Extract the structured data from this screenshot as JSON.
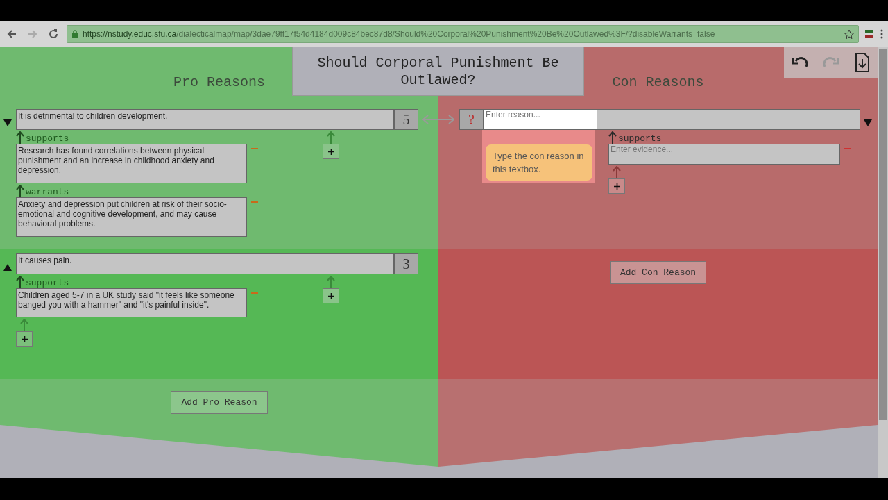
{
  "browser": {
    "url_host": "https://nstudy.educ.sfu.ca",
    "url_path": "/dialecticalmap/map/3dae79ff17f54d4184d009c84bec87d8/Should%20Corporal%20Punishment%20Be%20Outlawed%3F/?disableWarrants=false",
    "forward_disabled": true
  },
  "title": "Should Corporal Punishment Be Outlawed?",
  "toolbar": {
    "redo_disabled": true
  },
  "pro_heading": "Pro Reasons",
  "con_heading": "Con Reasons",
  "pro_reasons": [
    {
      "text": "It is detrimental to children development.",
      "score": "5",
      "expanded": true,
      "linked": true,
      "evidence": [
        {
          "relation": "supports",
          "text": "Research has found correlations between physical punishment and an increase in childhood anxiety and depression."
        },
        {
          "relation": "warrants",
          "text": "Anxiety and depression put children at risk of their socio-emotional and cognitive development, and may cause behavioral problems."
        }
      ]
    },
    {
      "text": "It causes pain.",
      "score": "3",
      "expanded": false,
      "linked": false,
      "evidence": [
        {
          "relation": "supports",
          "text": "Children aged 5-7 in a UK study said \"it feels like someone banged you with a hammer\" and \"it's painful inside\"."
        }
      ]
    }
  ],
  "con_reasons": [
    {
      "placeholder": "Enter reason...",
      "score": "?",
      "expanded": true,
      "evidence": [
        {
          "relation": "supports",
          "placeholder": "Enter evidence..."
        }
      ]
    }
  ],
  "tooltip": "Type the con reason in this textbox.",
  "add_pro": "Add Pro Reason",
  "add_con": "Add Con Reason"
}
